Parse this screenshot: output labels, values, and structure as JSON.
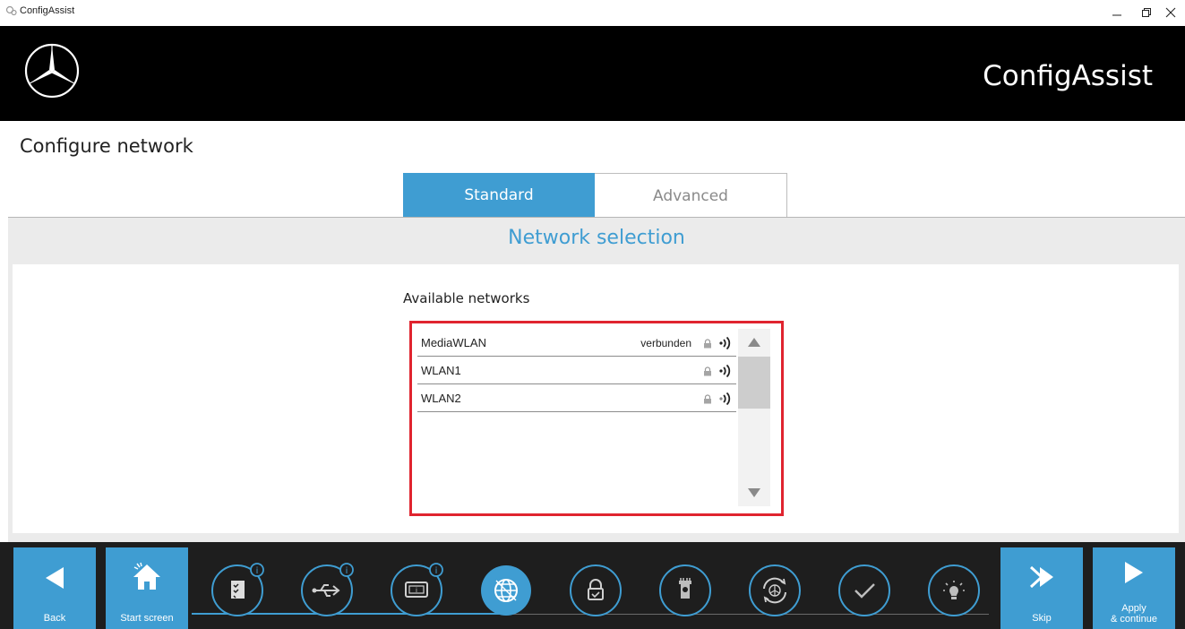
{
  "window": {
    "title": "ConfigAssist",
    "controls": [
      "minimize-icon",
      "restore-icon",
      "close-icon"
    ]
  },
  "header": {
    "logo": "mercedes-star-logo",
    "brand": "ConfigAssist"
  },
  "page": {
    "title": "Configure network"
  },
  "tabs": [
    {
      "label": "Standard",
      "active": true
    },
    {
      "label": "Advanced",
      "active": false
    }
  ],
  "section": {
    "title": "Network selection",
    "available_label": "Available networks"
  },
  "networks": [
    {
      "name": "MediaWLAN",
      "status": "verbunden",
      "icons": [
        "lock-icon",
        "signal-icon"
      ]
    },
    {
      "name": "WLAN1",
      "status": "",
      "icons": [
        "lock-icon",
        "signal-icon"
      ]
    },
    {
      "name": "WLAN2",
      "status": "",
      "icons": [
        "lock-icon",
        "signal-icon"
      ]
    }
  ],
  "footer": {
    "back_label": "Back",
    "start_label": "Start screen",
    "skip_label": "Skip",
    "apply_label_1": "Apply",
    "apply_label_2": "& continue",
    "steps": [
      {
        "icon": "checklist-icon",
        "info": true
      },
      {
        "icon": "usb-icon",
        "info": true
      },
      {
        "icon": "display-info-icon",
        "info": true
      },
      {
        "icon": "globe-icon",
        "info": false,
        "active": true
      },
      {
        "icon": "lock-icon",
        "info": false
      },
      {
        "icon": "tower-icon",
        "info": false
      },
      {
        "icon": "sync-icon",
        "info": false
      },
      {
        "icon": "check-icon",
        "info": false
      },
      {
        "icon": "lightbulb-icon",
        "info": false
      }
    ]
  },
  "colors": {
    "accent": "#3f9dd2",
    "highlight_border": "#e0242f",
    "header_bg": "#000000",
    "footer_bg": "#1e1e1e"
  }
}
